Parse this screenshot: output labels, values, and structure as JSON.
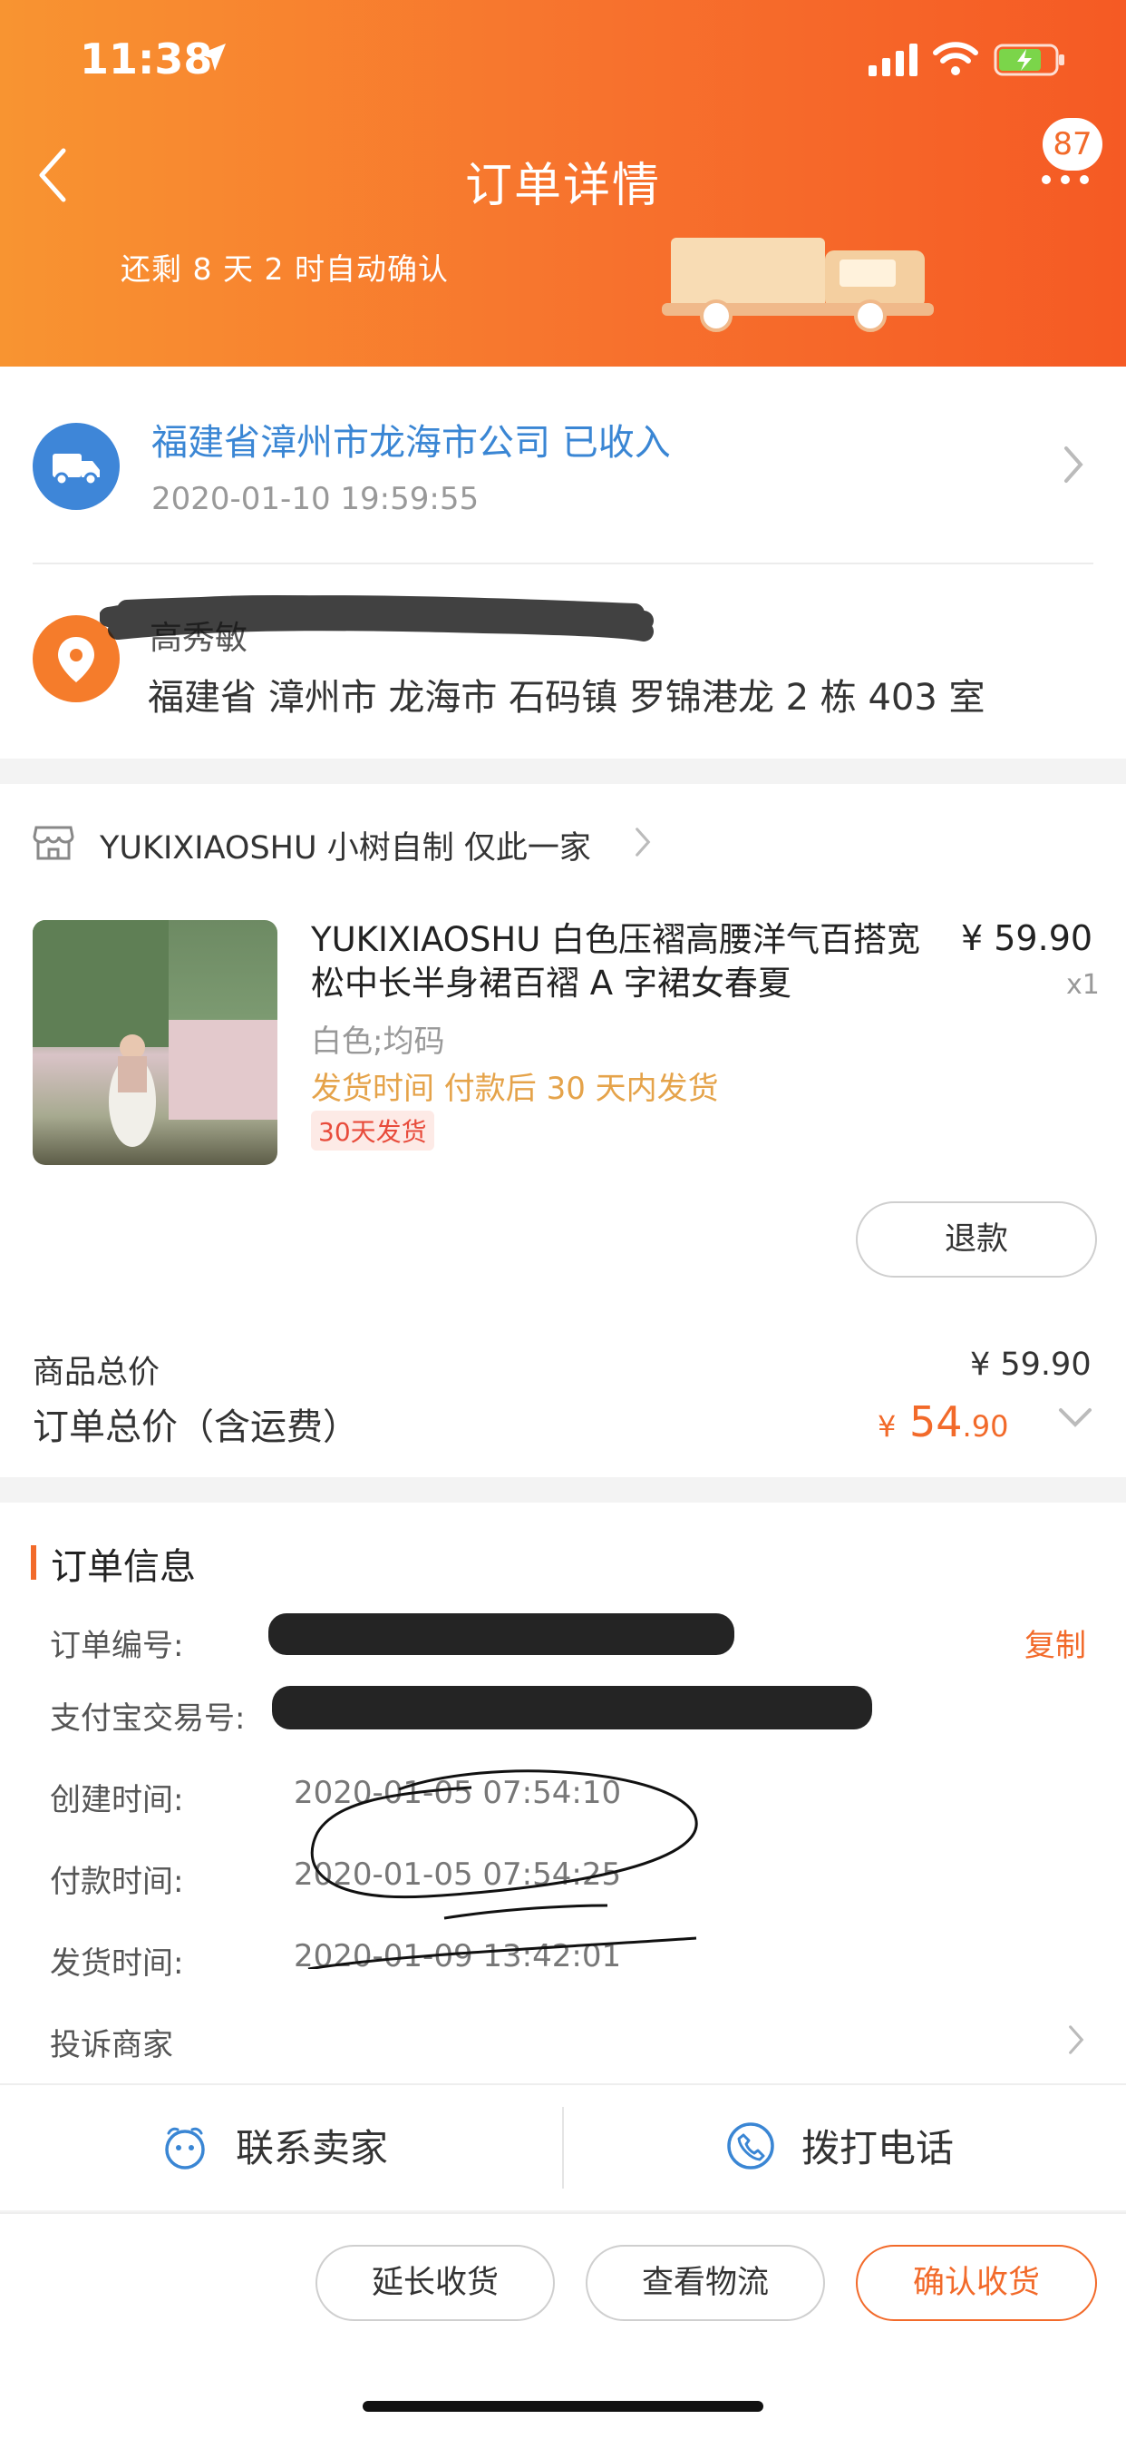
{
  "status_bar": {
    "time": "11:38"
  },
  "header": {
    "title": "订单详情",
    "badge_count": "87",
    "countdown": "还剩 8 天 2 时自动确认"
  },
  "logistics": {
    "status": "福建省漳州市龙海市公司 已收入",
    "time": "2020-01-10 19:59:55"
  },
  "receiver": {
    "name": "高秀敏",
    "address": "福建省 漳州市 龙海市 石码镇 罗锦港龙 2 栋 403 室"
  },
  "shop": {
    "name": "YUKIXIAOSHU 小树自制 仅此一家"
  },
  "product": {
    "title": "YUKIXIAOSHU 白色压褶高腰洋气百搭宽松中长半身裙百褶 A 字裙女春夏",
    "price": "¥ 59.90",
    "quantity": "x1",
    "sku": "白色;均码",
    "ship_note": "发货时间  付款后 30 天内发货",
    "ship_tag": "30天发货",
    "refund_label": "退款"
  },
  "summary": {
    "goods_total_label": "商品总价",
    "goods_total_value": "¥ 59.90",
    "order_total_label": "订单总价（含运费）",
    "order_total_currency": "¥",
    "order_total_int": "54",
    "order_total_dec": ".90"
  },
  "order_info": {
    "title": "订单信息",
    "order_no_label": "订单编号:",
    "alipay_label": "支付宝交易号:",
    "copy_label": "复制",
    "created_label": "创建时间:",
    "created_value": "2020-01-05 07:54:10",
    "paid_label": "付款时间:",
    "paid_value": "2020-01-05 07:54:25",
    "shipped_label": "发货时间:",
    "shipped_value": "2020-01-09 13:42:01",
    "complaint_label": "投诉商家"
  },
  "contact": {
    "seller_label": "联系卖家",
    "phone_label": "拨打电话"
  },
  "actions": {
    "extend_label": "延长收货",
    "logistics_label": "查看物流",
    "confirm_label": "确认收货"
  },
  "colors": {
    "accent": "#f26a2a",
    "link_blue": "#3a86d4",
    "ship_orange": "#e5a34a"
  }
}
